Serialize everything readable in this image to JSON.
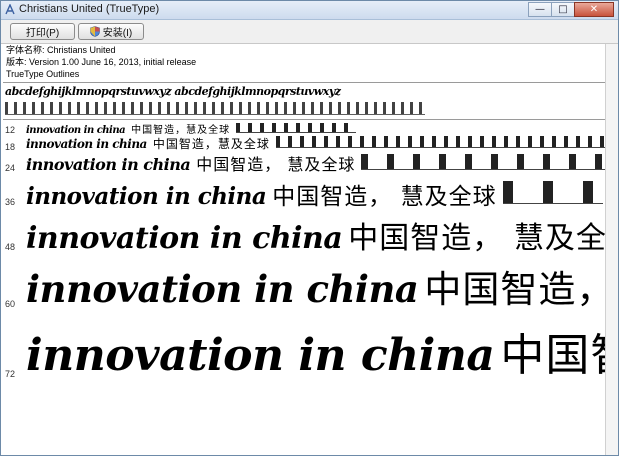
{
  "window": {
    "title": "Christians United  (TrueType)"
  },
  "controls": {
    "minimize": "—",
    "maximize": "□",
    "close": "✕"
  },
  "toolbar": {
    "print_label": "打印(P)",
    "install_label": "安装(I)"
  },
  "info": {
    "name_line": "字体名称: Christians United",
    "version_line": "版本: Version 1.00 June 16, 2013, initial release",
    "format_line": "TrueType Outlines"
  },
  "alphabet_sample": "abcdefghijklmnopqrstuvwxyz abcdefghijklmnopqrstuvwxyz",
  "samples": [
    {
      "size": "12",
      "latin": "innovation in china",
      "cjk": "中国智造，慧及全球"
    },
    {
      "size": "18",
      "latin": "innovation in china",
      "cjk": "中国智造，慧及全球"
    },
    {
      "size": "24",
      "latin": "innovation in china",
      "cjk": "中国智造，  慧及全球"
    },
    {
      "size": "36",
      "latin": "innovation in china",
      "cjk": "中国智造，  慧及全球"
    },
    {
      "size": "48",
      "latin": "innovation in china",
      "cjk": "中国智造，  慧及全"
    },
    {
      "size": "60",
      "latin": "innovation in china",
      "cjk": "中国智造，"
    },
    {
      "size": "72",
      "latin": "innovation in china",
      "cjk": "中国智"
    }
  ],
  "icons": {
    "app": "font-icon",
    "install": "shield-icon"
  }
}
